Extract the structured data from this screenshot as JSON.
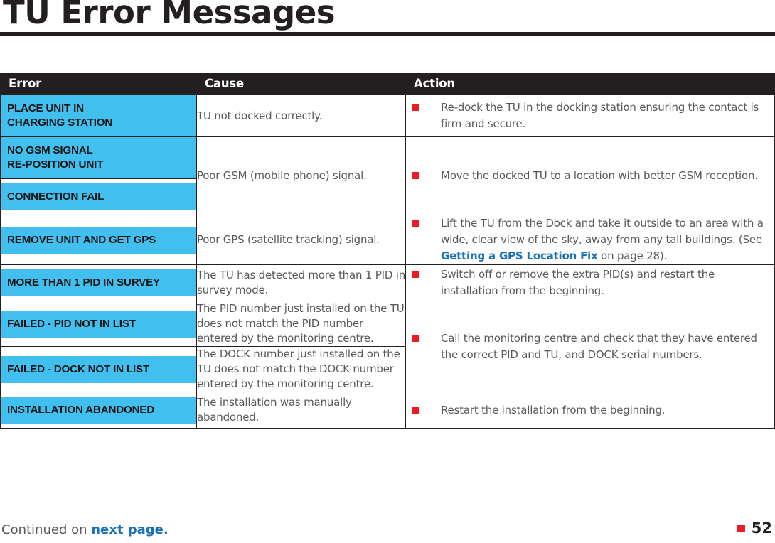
{
  "page": {
    "title": "TU Error Messages",
    "number": "52",
    "continued_prefix": "Continued on ",
    "continued_link": "next page."
  },
  "table": {
    "headers": {
      "error": "Error",
      "cause": "Cause",
      "action": "Action"
    },
    "rows": [
      {
        "error": "PLACE UNIT IN\nCHARGING STATION",
        "cause": "TU not docked correctly.",
        "action": "Re-dock the TU in the docking station ensuring the contact is firm and secure."
      },
      {
        "error": "NO GSM SIGNAL\nRE-POSITION UNIT",
        "cause": "Poor GSM (mobile phone) signal.",
        "action": "Move the docked TU to a location with better GSM reception."
      },
      {
        "error": "CONNECTION FAIL",
        "cause": "",
        "action": ""
      },
      {
        "error": "REMOVE UNIT AND GET GPS",
        "cause": "Poor GPS (satellite tracking) signal.",
        "action_parts": {
          "before": "Lift the TU from the Dock and take it outside to an area with a wide, clear view of the sky, away from any tall buildings. (See ",
          "link": "Getting a GPS Location Fix",
          "after": " on page 28)."
        }
      },
      {
        "error": "MORE THAN 1 PID IN SURVEY",
        "cause": "The TU has detected more than 1 PID in survey mode.",
        "action": "Switch off or remove the extra PID(s) and restart the installation from the beginning."
      },
      {
        "error": "FAILED - PID NOT IN LIST",
        "cause": "The PID number just installed on the TU does not match the PID number entered by the monitoring centre.",
        "action": "Call the monitoring centre and check that they have entered the correct PID and TU, and DOCK serial numbers."
      },
      {
        "error": "FAILED - DOCK NOT IN LIST",
        "cause": "The DOCK number just installed on the TU does not match the DOCK number entered by the monitoring centre.",
        "action": ""
      },
      {
        "error": "INSTALLATION ABANDONED",
        "cause": "The installation was manually abandoned.",
        "action": "Restart the installation from the beginning."
      }
    ]
  },
  "colors": {
    "error_chip": "#41c0f0",
    "header_bar": "#231f20",
    "bullet_red": "#ed1c24",
    "link_blue": "#1a72b8",
    "body_text": "#58595b"
  }
}
